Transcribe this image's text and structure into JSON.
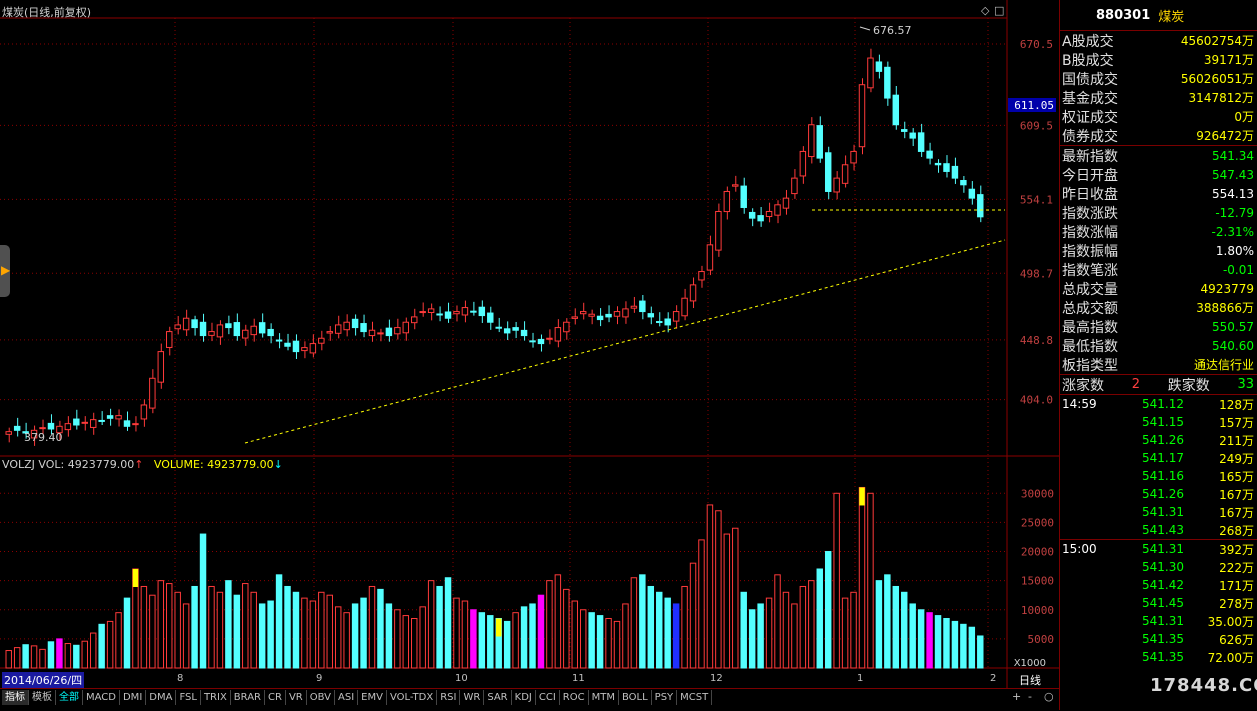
{
  "chart_title": "煤炭(日线,前复权)",
  "vol_title": {
    "a": "VOLZJ VOL: 4923779.00",
    "b": "VOLUME: 4923779.00"
  },
  "price_axis": [
    "670.5",
    "609.5",
    "554.1",
    "498.7",
    "448.8",
    "404.0"
  ],
  "current_price_tag": "611.05",
  "peak_label": "676.57",
  "low_label": "379.40",
  "vol_axis": [
    "30000",
    "25000",
    "20000",
    "15000",
    "10000",
    "5000"
  ],
  "vol_unit": "X1000",
  "month_labels": [
    "8",
    "9",
    "10",
    "11",
    "12",
    "1",
    "2"
  ],
  "date_label": "2014/06/26/四",
  "line_label": "日线",
  "tabs": [
    "指标",
    "模板",
    "全部",
    "MACD",
    "DMI",
    "DMA",
    "FSL",
    "TRIX",
    "BRAR",
    "CR",
    "VR",
    "OBV",
    "ASI",
    "EMV",
    "VOL-TDX",
    "RSI",
    "WR",
    "SAR",
    "KDJ",
    "CCI",
    "ROC",
    "MTM",
    "BOLL",
    "PSY",
    "MCST"
  ],
  "controls": {
    "plus": "+",
    "minus": "-",
    "circle": "○"
  },
  "sidebar": {
    "code": "880301",
    "name": "煤炭",
    "sec1": [
      {
        "k": "Α股成交",
        "v": "45602754万"
      },
      {
        "k": "Β股成交",
        "v": "39171万"
      },
      {
        "k": "国债成交",
        "v": "56026051万"
      },
      {
        "k": "基金成交",
        "v": "3147812万"
      },
      {
        "k": "权证成交",
        "v": "0万"
      },
      {
        "k": "债券成交",
        "v": "926472万"
      }
    ],
    "sec2": [
      {
        "k": "最新指数",
        "v": "541.34",
        "c": "green"
      },
      {
        "k": "今日开盘",
        "v": "547.43",
        "c": "green"
      },
      {
        "k": "昨日收盘",
        "v": "554.13",
        "c": "white"
      },
      {
        "k": "指数涨跌",
        "v": "-12.79",
        "c": "green"
      },
      {
        "k": "指数涨幅",
        "v": "-2.31%",
        "c": "green"
      },
      {
        "k": "指数振幅",
        "v": "1.80%",
        "c": "white"
      },
      {
        "k": "指数笔涨",
        "v": "-0.01",
        "c": "green"
      },
      {
        "k": "总成交量",
        "v": "4923779",
        "c": "yellow"
      },
      {
        "k": "总成交额",
        "v": "388866万",
        "c": "yellow"
      },
      {
        "k": "最高指数",
        "v": "550.57",
        "c": "green"
      },
      {
        "k": "最低指数",
        "v": "540.60",
        "c": "green"
      },
      {
        "k": "板指类型",
        "v": "通达信行业",
        "c": "yellow"
      }
    ],
    "updown": {
      "up_label": "涨家数",
      "up": "2",
      "down_label": "跌家数",
      "down": "33"
    },
    "ticks": [
      {
        "t": "14:59",
        "p": "541.12",
        "q": "128万"
      },
      {
        "t": "",
        "p": "541.15",
        "q": "157万"
      },
      {
        "t": "",
        "p": "541.26",
        "q": "211万"
      },
      {
        "t": "",
        "p": "541.17",
        "q": "249万"
      },
      {
        "t": "",
        "p": "541.16",
        "q": "165万"
      },
      {
        "t": "",
        "p": "541.26",
        "q": "167万"
      },
      {
        "t": "",
        "p": "541.31",
        "q": "167万"
      },
      {
        "t": "",
        "p": "541.43",
        "q": "268万"
      },
      {
        "t": "15:00",
        "p": "541.31",
        "q": "392万"
      },
      {
        "t": "",
        "p": "541.30",
        "q": "222万"
      },
      {
        "t": "",
        "p": "541.42",
        "q": "171万"
      },
      {
        "t": "",
        "p": "541.45",
        "q": "278万"
      },
      {
        "t": "",
        "p": "541.31",
        "q": "35.00万"
      },
      {
        "t": "",
        "p": "541.35",
        "q": "626万"
      },
      {
        "t": "",
        "p": "541.35",
        "q": "72.00万"
      }
    ]
  },
  "watermark": "178448.COM",
  "chart_data": {
    "type": "candlestick",
    "price_ylim": [
      370,
      690
    ],
    "volume_ylim": [
      0,
      34000
    ],
    "series_note": "daily OHLC approx.",
    "closes": [
      380,
      381,
      379,
      381,
      383,
      382,
      384,
      386,
      385,
      387,
      389,
      388,
      390,
      392,
      384,
      386,
      400,
      420,
      440,
      455,
      460,
      465,
      458,
      452,
      455,
      460,
      458,
      452,
      456,
      459,
      454,
      452,
      448,
      444,
      440,
      443,
      446,
      450,
      455,
      460,
      462,
      458,
      455,
      456,
      454,
      452,
      458,
      462,
      466,
      470,
      472,
      468,
      465,
      470,
      473,
      470,
      467,
      462,
      458,
      454,
      456,
      452,
      448,
      446,
      450,
      458,
      462,
      466,
      470,
      468,
      464,
      466,
      470,
      472,
      474,
      470,
      466,
      462,
      460,
      470,
      480,
      490,
      500,
      520,
      545,
      560,
      565,
      548,
      540,
      538,
      545,
      550,
      555,
      570,
      590,
      610,
      585,
      560,
      570,
      580,
      590,
      640,
      660,
      650,
      630,
      610,
      605,
      600,
      590,
      585,
      580,
      575,
      570,
      565,
      555,
      541
    ],
    "volumes": [
      3000,
      3500,
      4000,
      3800,
      3200,
      4500,
      5000,
      4200,
      3900,
      4600,
      6000,
      7500,
      8000,
      9500,
      12000,
      17000,
      14000,
      12500,
      15000,
      14500,
      13000,
      11000,
      14000,
      23000,
      14000,
      13000,
      15000,
      12500,
      14500,
      13000,
      11000,
      11500,
      16000,
      14000,
      13000,
      12000,
      11500,
      13000,
      12500,
      10500,
      9500,
      11000,
      12000,
      14000,
      13500,
      11000,
      10000,
      9000,
      8500,
      10500,
      15000,
      14000,
      15500,
      12000,
      11500,
      10000,
      9500,
      9000,
      8500,
      8000,
      9500,
      10500,
      11000,
      12500,
      15000,
      16000,
      13500,
      11500,
      10000,
      9500,
      9000,
      8500,
      8000,
      11000,
      15500,
      16000,
      14000,
      13000,
      12000,
      11000,
      14000,
      18000,
      22000,
      28000,
      27000,
      23000,
      24000,
      13000,
      10000,
      11000,
      12000,
      16000,
      13000,
      11000,
      14000,
      15000,
      17000,
      20000,
      30000,
      12000,
      13000,
      31000,
      30000,
      15000,
      16000,
      14000,
      13000,
      11000,
      10000,
      9500,
      9000,
      8500,
      8000,
      7500,
      7000,
      5500
    ],
    "highlight": {
      "yellow": [
        15,
        58,
        101
      ],
      "magenta": [
        6,
        55,
        63,
        109,
        116
      ],
      "blue": [
        79
      ]
    }
  }
}
